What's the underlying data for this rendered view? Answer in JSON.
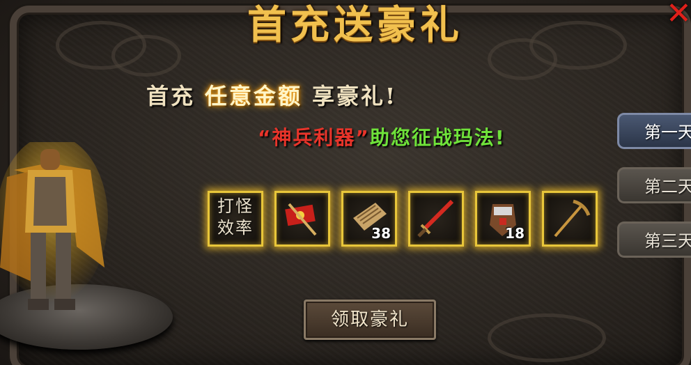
{
  "title": "首充送豪礼",
  "subtitle": {
    "prefix": "首充",
    "highlight": "任意金额",
    "suffix": "享豪礼!"
  },
  "slogan": {
    "quoted": "“神兵利器”",
    "rest": "助您征战玛法!"
  },
  "tabs": [
    {
      "label": "第一天",
      "active": true
    },
    {
      "label": "第二天",
      "active": false
    },
    {
      "label": "第三天",
      "active": false
    }
  ],
  "rewards": [
    {
      "icon": "attack-efficiency-icon",
      "label": "打怪效率",
      "qty": ""
    },
    {
      "icon": "red-banner-icon",
      "qty": ""
    },
    {
      "icon": "scroll-icon",
      "qty": "38"
    },
    {
      "icon": "red-sword-icon",
      "qty": ""
    },
    {
      "icon": "fist-armor-icon",
      "qty": "18"
    },
    {
      "icon": "pickaxe-icon",
      "qty": ""
    }
  ],
  "claim_button": "领取豪礼",
  "colors": {
    "gold": "#f1c04e",
    "red_text": "#e8342a",
    "green_text": "#6fe23a",
    "slot_glow": "#e8c63a",
    "close": "#e0201a"
  }
}
